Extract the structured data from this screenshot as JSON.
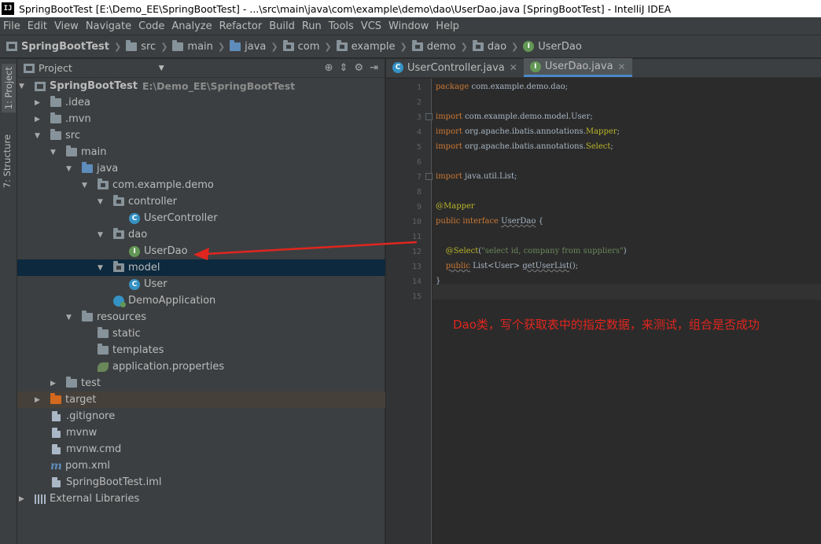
{
  "window": {
    "title": "SpringBootTest [E:\\Demo_EE\\SpringBootTest] - ...\\src\\main\\java\\com\\example\\demo\\dao\\UserDao.java [SpringBootTest] - IntelliJ IDEA",
    "logo_text": "IJ"
  },
  "menu": [
    "File",
    "Edit",
    "View",
    "Navigate",
    "Code",
    "Analyze",
    "Refactor",
    "Build",
    "Run",
    "Tools",
    "VCS",
    "Window",
    "Help"
  ],
  "breadcrumb": [
    "SpringBootTest",
    "src",
    "main",
    "java",
    "com",
    "example",
    "demo",
    "dao",
    "UserDao"
  ],
  "side_tabs": {
    "project": "1: Project",
    "structure": "7: Structure"
  },
  "project_panel": {
    "header": "Project",
    "tree": [
      {
        "label": "SpringBootTest",
        "path": "E:\\Demo_EE\\SpringBootTest",
        "icon": "project-icon",
        "expanded": true
      },
      {
        "label": ".idea",
        "icon": "folder-icon",
        "expanded": false
      },
      {
        "label": ".mvn",
        "icon": "folder-icon",
        "expanded": false
      },
      {
        "label": "src",
        "icon": "folder-icon",
        "expanded": true
      },
      {
        "label": "main",
        "icon": "folder-icon",
        "expanded": true
      },
      {
        "label": "java",
        "icon": "source-folder-icon",
        "expanded": true
      },
      {
        "label": "com.example.demo",
        "icon": "package-icon",
        "expanded": true
      },
      {
        "label": "controller",
        "icon": "package-icon",
        "expanded": true
      },
      {
        "label": "UserController",
        "icon": "class-icon"
      },
      {
        "label": "dao",
        "icon": "package-icon",
        "expanded": true
      },
      {
        "label": "UserDao",
        "icon": "interface-icon"
      },
      {
        "label": "model",
        "icon": "package-icon",
        "expanded": true
      },
      {
        "label": "User",
        "icon": "class-icon"
      },
      {
        "label": "DemoApplication",
        "icon": "spring-app-icon"
      },
      {
        "label": "resources",
        "icon": "resources-folder-icon",
        "expanded": true
      },
      {
        "label": "static",
        "icon": "folder-icon"
      },
      {
        "label": "templates",
        "icon": "folder-icon"
      },
      {
        "label": "application.properties",
        "icon": "spring-leaf-icon"
      },
      {
        "label": "test",
        "icon": "folder-icon",
        "expanded": false
      },
      {
        "label": "target",
        "icon": "excluded-folder-icon",
        "expanded": false
      },
      {
        "label": ".gitignore",
        "icon": "file-icon"
      },
      {
        "label": "mvnw",
        "icon": "file-icon"
      },
      {
        "label": "mvnw.cmd",
        "icon": "file-icon"
      },
      {
        "label": "pom.xml",
        "icon": "maven-icon"
      },
      {
        "label": "SpringBootTest.iml",
        "icon": "file-icon"
      },
      {
        "label": "External Libraries",
        "icon": "library-icon",
        "expanded": false
      }
    ]
  },
  "editor": {
    "tabs": [
      {
        "label": "UserController.java",
        "icon": "class-icon",
        "active": false
      },
      {
        "label": "UserDao.java",
        "icon": "interface-icon",
        "active": true
      }
    ],
    "lines": {
      "l1_kw": "package",
      "l1_rest": " com.example.demo.dao;",
      "l3_kw": "import",
      "l3_rest": " com.example.demo.model.User;",
      "l4_kw": "import",
      "l4_a": " org.apache.ibatis.annotations.",
      "l4_b": "Mapper",
      "l4_c": ";",
      "l5_kw": "import",
      "l5_a": " org.apache.ibatis.annotations.",
      "l5_b": "Select",
      "l5_c": ";",
      "l7_kw": "import",
      "l7_rest": " java.util.List;",
      "l9_ann": "@Mapper",
      "l10_kw": "public interface",
      "l10_name": "UserDao",
      "l10_rest": " {",
      "l12_ann": "@Select",
      "l12_p1": "(",
      "l12_str": "\"select id, company from suppliers\"",
      "l12_p2": ")",
      "l13_kw": "public",
      "l13_rest": " List<User> ",
      "l13_m": "getUserList",
      "l13_end": "();",
      "l14": "}"
    }
  },
  "annotation_note": "Dao类，写个获取表中的指定数据，来测试，组合是否成功",
  "colors": {
    "note": "#e0261f",
    "arrow": "#e0261f",
    "selection": "#0d293e"
  }
}
